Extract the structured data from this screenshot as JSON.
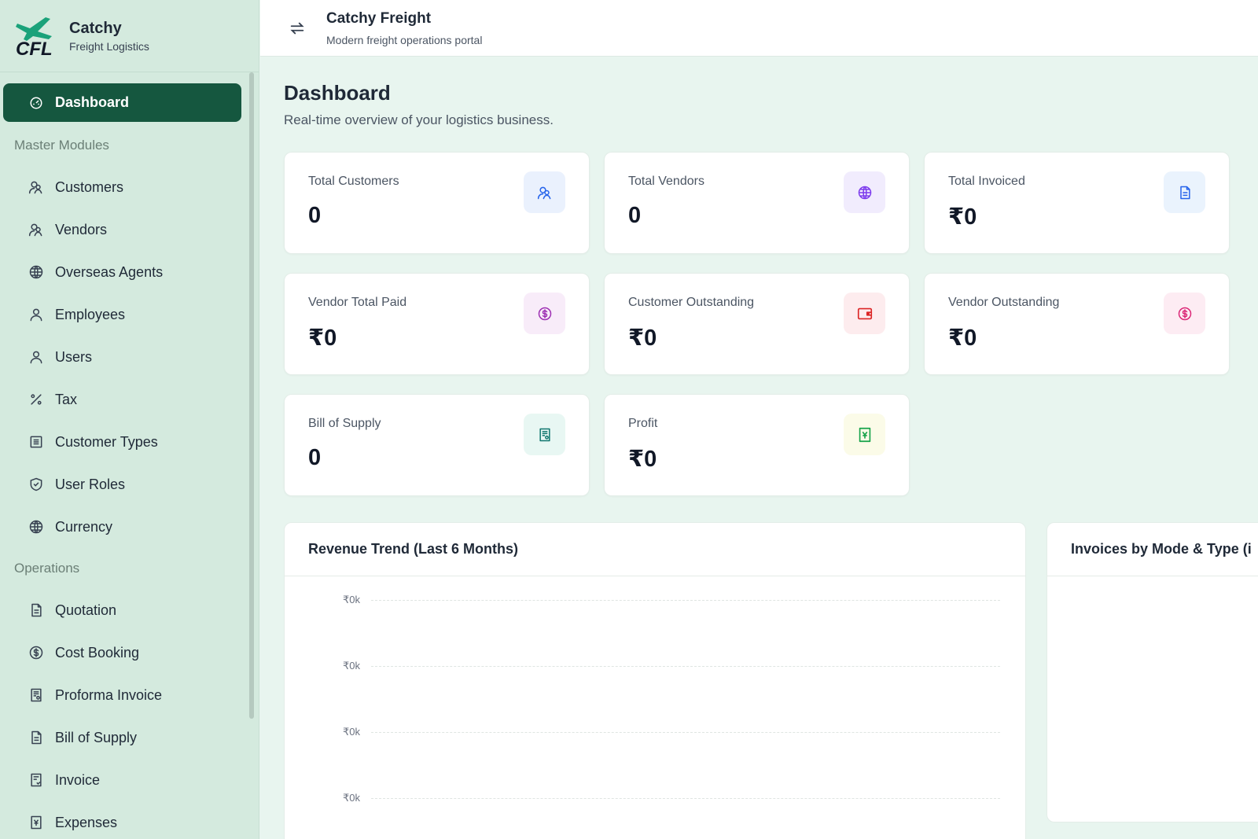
{
  "brand": {
    "name": "Catchy",
    "subtitle": "Freight Logistics",
    "logo_text": "CFL"
  },
  "header": {
    "title": "Catchy Freight",
    "subtitle": "Modern freight operations portal"
  },
  "sidebar": {
    "dashboard": "Dashboard",
    "section_master": "Master Modules",
    "master_items": [
      {
        "label": "Customers",
        "icon": "users-icon"
      },
      {
        "label": "Vendors",
        "icon": "users-icon"
      },
      {
        "label": "Overseas Agents",
        "icon": "globe-icon"
      },
      {
        "label": "Employees",
        "icon": "user-icon"
      },
      {
        "label": "Users",
        "icon": "user-icon"
      },
      {
        "label": "Tax",
        "icon": "percent-icon"
      },
      {
        "label": "Customer Types",
        "icon": "list-icon"
      },
      {
        "label": "User Roles",
        "icon": "shield-icon"
      },
      {
        "label": "Currency",
        "icon": "globe-icon"
      }
    ],
    "section_operations": "Operations",
    "operation_items": [
      {
        "label": "Quotation",
        "icon": "document-icon"
      },
      {
        "label": "Cost Booking",
        "icon": "dollar-circle-icon"
      },
      {
        "label": "Proforma Invoice",
        "icon": "receipt-icon"
      },
      {
        "label": "Bill of Supply",
        "icon": "document-icon"
      },
      {
        "label": "Invoice",
        "icon": "invoice-icon"
      },
      {
        "label": "Expenses",
        "icon": "expense-icon"
      }
    ]
  },
  "page": {
    "title": "Dashboard",
    "subtitle": "Real-time overview of your logistics business."
  },
  "cards": [
    {
      "label": "Total Customers",
      "value": "0",
      "icon": "users-icon",
      "color": "#2563eb",
      "bg": "#eaf1fd"
    },
    {
      "label": "Total Vendors",
      "value": "0",
      "icon": "globe-icon",
      "color": "#7c3aed",
      "bg": "#f1ecfd"
    },
    {
      "label": "Total Invoiced",
      "value": "₹0",
      "icon": "document-icon",
      "color": "#2563eb",
      "bg": "#eaf3fd"
    },
    {
      "label": "Vendor Total Paid",
      "value": "₹0",
      "icon": "dollar-circle-icon",
      "color": "#9d2fb3",
      "bg": "#f8ecf9"
    },
    {
      "label": "Customer Outstanding",
      "value": "₹0",
      "icon": "wallet-icon",
      "color": "#dc2626",
      "bg": "#fdecee"
    },
    {
      "label": "Vendor Outstanding",
      "value": "₹0",
      "icon": "dollar-circle-icon",
      "color": "#db2777",
      "bg": "#fdecf3"
    },
    {
      "label": "Bill of Supply",
      "value": "0",
      "icon": "receipt-icon",
      "color": "#0f766e",
      "bg": "#e8f7f3"
    },
    {
      "label": "Profit",
      "value": "₹0",
      "icon": "yen-document-icon",
      "color": "#16a34a",
      "bg": "#fbfbe8"
    }
  ],
  "revenue_panel": {
    "title": "Revenue Trend (Last 6 Months)"
  },
  "invoices_panel": {
    "title": "Invoices by Mode & Type (i"
  },
  "chart_data": {
    "type": "line",
    "title": "Revenue Trend (Last 6 Months)",
    "ytick_labels": [
      "₹0k",
      "₹0k",
      "₹0k",
      "₹0k"
    ],
    "series": []
  }
}
